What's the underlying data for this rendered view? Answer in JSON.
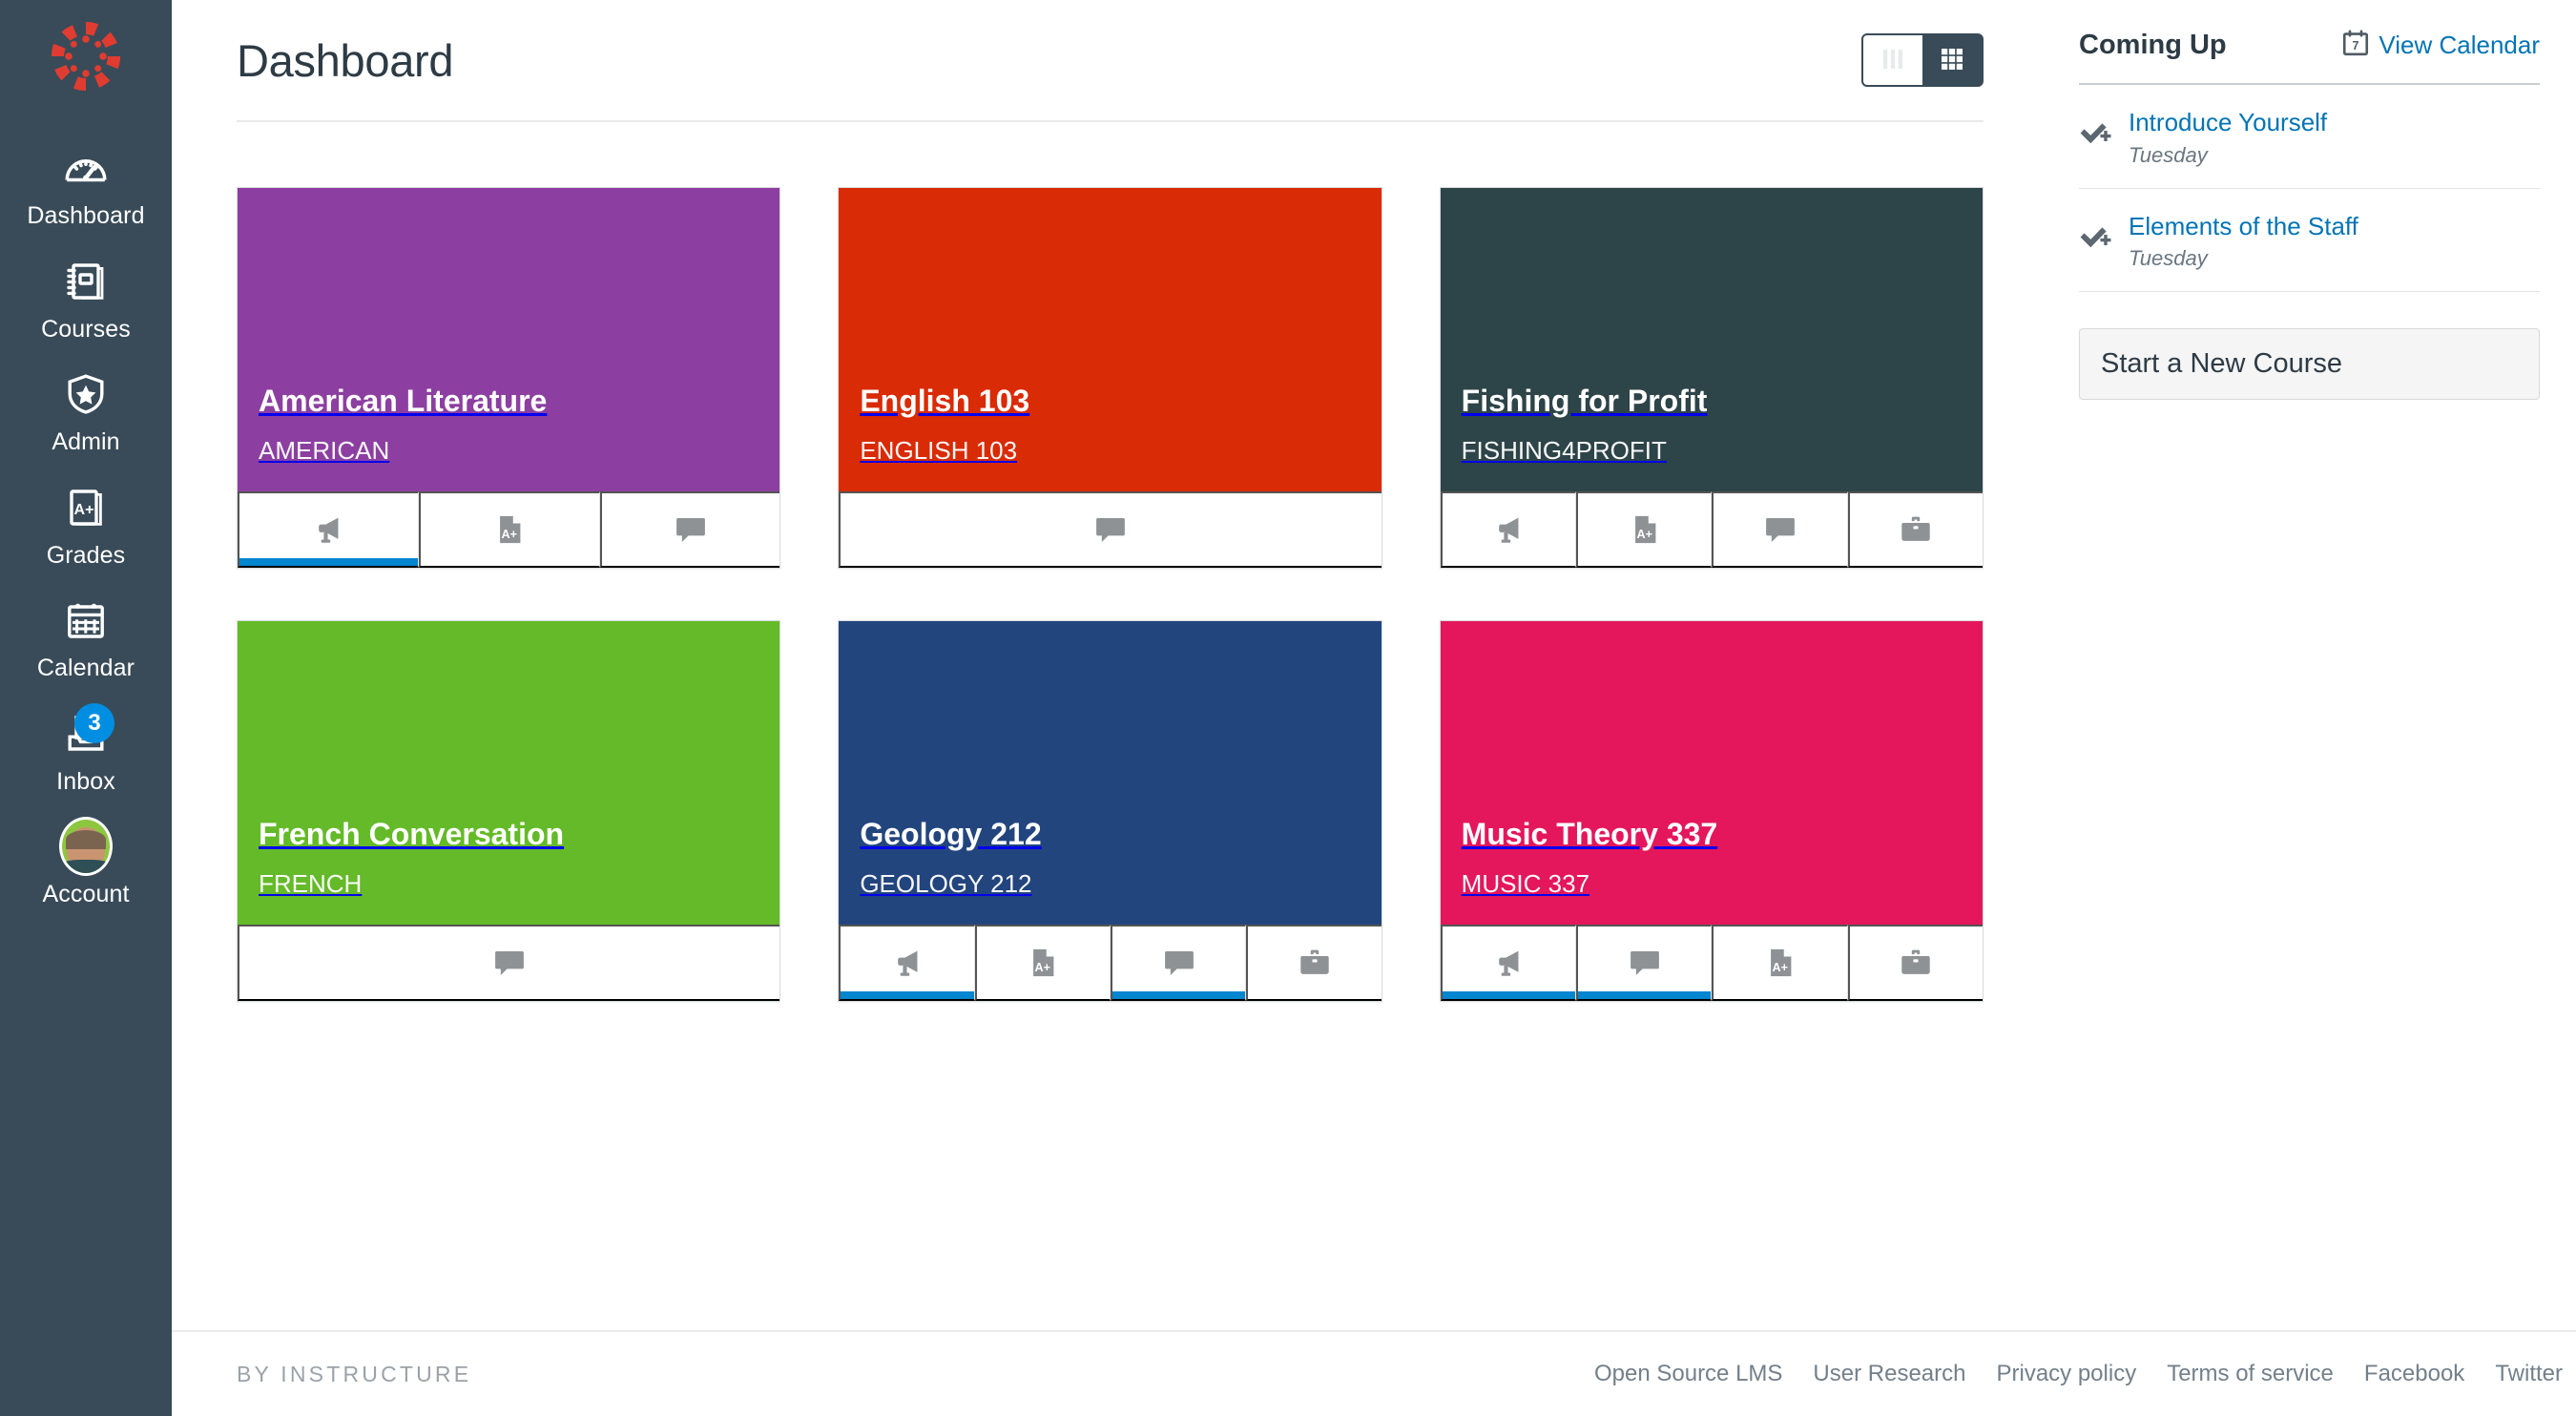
{
  "sidebar": {
    "logo_name": "canvas-logo",
    "items": [
      {
        "id": "dashboard",
        "label": "Dashboard",
        "icon": "dashboard-icon",
        "badge": null
      },
      {
        "id": "courses",
        "label": "Courses",
        "icon": "courses-icon",
        "badge": null
      },
      {
        "id": "admin",
        "label": "Admin",
        "icon": "admin-shield-icon",
        "badge": null
      },
      {
        "id": "grades",
        "label": "Grades",
        "icon": "grades-icon",
        "badge": null
      },
      {
        "id": "calendar",
        "label": "Calendar",
        "icon": "calendar-icon",
        "badge": null
      },
      {
        "id": "inbox",
        "label": "Inbox",
        "icon": "inbox-icon",
        "badge": "3"
      },
      {
        "id": "account",
        "label": "Account",
        "icon": "avatar-icon",
        "badge": null
      }
    ]
  },
  "header": {
    "title": "Dashboard",
    "view_toggle": {
      "list_view_label": "list-view",
      "grid_view_label": "grid-view",
      "active": "grid-view"
    }
  },
  "courses": [
    {
      "name": "American Literature",
      "code": "AMERICAN",
      "color": "#8C3FA1",
      "actions": [
        {
          "icon": "announcements-icon",
          "active": true
        },
        {
          "icon": "assignments-icon",
          "active": false
        },
        {
          "icon": "discussions-icon",
          "active": false
        }
      ]
    },
    {
      "name": "English 103",
      "code": "ENGLISH 103",
      "color": "#D92B06",
      "actions": [
        {
          "icon": "discussions-icon",
          "active": false
        }
      ]
    },
    {
      "name": "Fishing for Profit",
      "code": "FISHING4PROFIT",
      "color": "#2D4448",
      "actions": [
        {
          "icon": "announcements-icon",
          "active": false
        },
        {
          "icon": "assignments-icon",
          "active": false
        },
        {
          "icon": "discussions-icon",
          "active": false
        },
        {
          "icon": "files-icon",
          "active": false
        }
      ]
    },
    {
      "name": "French Conversation",
      "code": "FRENCH",
      "color": "#64BA28",
      "actions": [
        {
          "icon": "discussions-icon",
          "active": false
        }
      ]
    },
    {
      "name": "Geology 212",
      "code": "GEOLOGY 212",
      "color": "#23457E",
      "actions": [
        {
          "icon": "announcements-icon",
          "active": true
        },
        {
          "icon": "assignments-icon",
          "active": false
        },
        {
          "icon": "discussions-icon",
          "active": true
        },
        {
          "icon": "files-icon",
          "active": false
        }
      ]
    },
    {
      "name": "Music Theory 337",
      "code": "MUSIC 337",
      "color": "#E4175C",
      "actions": [
        {
          "icon": "announcements-icon",
          "active": true
        },
        {
          "icon": "discussions-icon",
          "active": true
        },
        {
          "icon": "assignments-icon",
          "active": false
        },
        {
          "icon": "files-icon",
          "active": false
        }
      ]
    }
  ],
  "right_rail": {
    "title": "Coming Up",
    "view_calendar_label": "View Calendar",
    "calendar_icon_day": "7",
    "items": [
      {
        "title": "Introduce Yourself",
        "due": "Tuesday",
        "icon": "check-plus-icon"
      },
      {
        "title": "Elements of the Staff",
        "due": "Tuesday",
        "icon": "check-plus-icon"
      }
    ],
    "start_course_label": "Start a New Course"
  },
  "footer": {
    "brand": "BY INSTRUCTURE",
    "links": [
      "Open Source LMS",
      "User Research",
      "Privacy policy",
      "Terms of service",
      "Facebook",
      "Twitter"
    ]
  },
  "colors": {
    "sidebar_bg": "#394B58",
    "link_blue": "#0374B5",
    "active_bar": "#0385CF",
    "badge_blue": "#008EE2"
  }
}
